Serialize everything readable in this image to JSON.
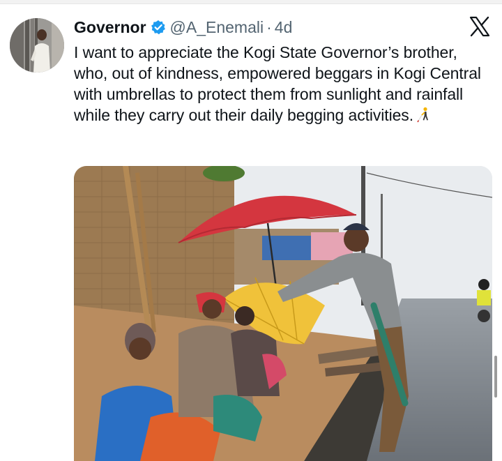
{
  "tweet": {
    "author": {
      "display_name": "Governor",
      "handle": "@A_Enemali",
      "verified": true
    },
    "separator": "·",
    "timestamp": "4d",
    "text": "I want to appreciate the Kogi State Governor’s brother, who, out of kindness, empowered beggars in Kogi Central with umbrellas to protect them from sunlight and rainfall while they carry out their daily begging activities.",
    "emoji": "person-with-white-cane-icon"
  },
  "icons": {
    "avatar": "avatar",
    "verified": "verified-badge-icon",
    "platform": "x-logo-icon"
  },
  "colors": {
    "verified_blue": "#1d9bf0",
    "text": "#0f1419",
    "muted": "#536471"
  }
}
